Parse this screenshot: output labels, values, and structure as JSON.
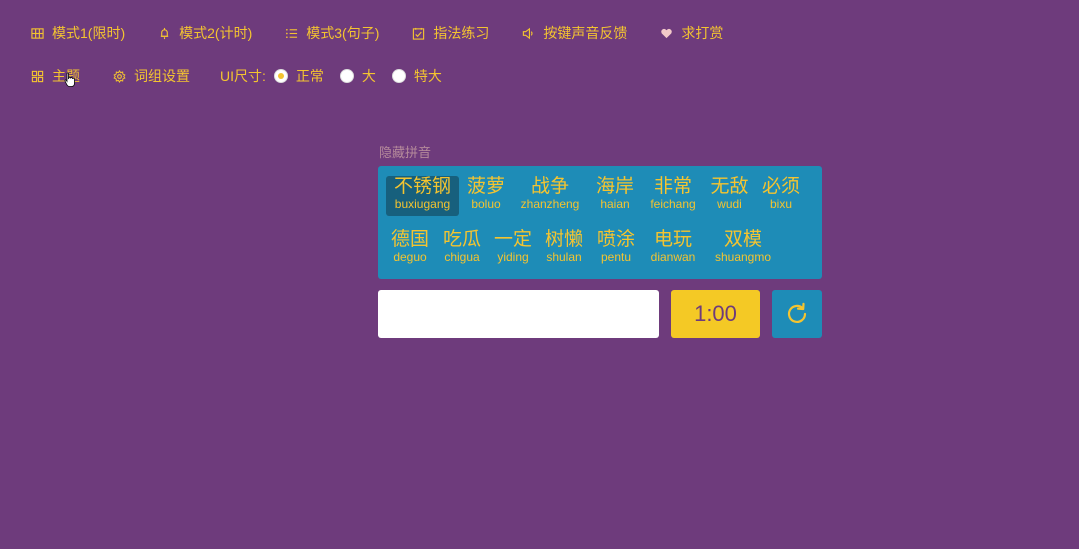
{
  "toolbar": {
    "row1": [
      {
        "id": "mode1",
        "label": "模式1(限时)",
        "icon": "grid-icon"
      },
      {
        "id": "mode2",
        "label": "模式2(计时)",
        "icon": "bell-icon"
      },
      {
        "id": "mode3",
        "label": "模式3(句子)",
        "icon": "list-icon"
      },
      {
        "id": "practice",
        "label": "指法练习",
        "icon": "checkbox-icon"
      },
      {
        "id": "sound",
        "label": "按键声音反馈",
        "icon": "speaker-icon"
      },
      {
        "id": "donate",
        "label": "求打赏",
        "icon": "heart-icon"
      }
    ],
    "theme_label": "主题",
    "wordgroup_label": "词组设置",
    "ui_size_label": "UI尺寸:",
    "ui_size_options": [
      "正常",
      "大",
      "特大"
    ],
    "ui_size_selected": "正常"
  },
  "hide_pinyin_label": "隐藏拼音",
  "words": [
    {
      "hz": "不锈钢",
      "py": "buxiugang"
    },
    {
      "hz": "菠萝",
      "py": "boluo"
    },
    {
      "hz": "战争",
      "py": "zhanzheng"
    },
    {
      "hz": "海岸",
      "py": "haian"
    },
    {
      "hz": "非常",
      "py": "feichang"
    },
    {
      "hz": "无敌",
      "py": "wudi"
    },
    {
      "hz": "必须",
      "py": "bixu"
    },
    {
      "hz": "德国",
      "py": "deguo"
    },
    {
      "hz": "吃瓜",
      "py": "chigua"
    },
    {
      "hz": "一定",
      "py": "yiding"
    },
    {
      "hz": "树懒",
      "py": "shulan"
    },
    {
      "hz": "喷涂",
      "py": "pentu"
    },
    {
      "hz": "电玩",
      "py": "dianwan"
    },
    {
      "hz": "双模",
      "py": "shuangmo"
    }
  ],
  "current_word_index": 0,
  "input": {
    "value": "",
    "placeholder": ""
  },
  "timer": "1:00",
  "colors": {
    "background": "#6e3b7c",
    "accent": "#f4c430",
    "panel": "#1e8cb7",
    "current_word": "#17607d"
  }
}
